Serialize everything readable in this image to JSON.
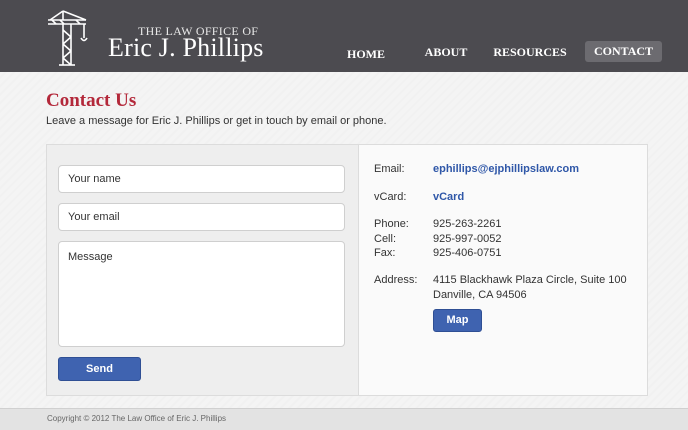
{
  "header": {
    "logo_line1": "THE LAW OFFICE OF",
    "logo_line2": "Eric J. Phillips",
    "logo_icon": "crane-icon",
    "nav": [
      {
        "label": "HOME",
        "active": false
      },
      {
        "label": "ABOUT",
        "active": false
      },
      {
        "label": "RESOURCES",
        "active": false
      },
      {
        "label": "CONTACT",
        "active": true
      }
    ]
  },
  "main": {
    "title": "Contact Us",
    "subtitle": "Leave a message for Eric J. Phillips or get in touch by email or phone."
  },
  "form": {
    "name_placeholder": "Your name",
    "email_placeholder": "Your email",
    "message_placeholder": "Message",
    "send_label": "Send"
  },
  "contact": {
    "email_label": "Email:",
    "email_value": "ephillips@ejphillipslaw.com",
    "vcard_label": "vCard:",
    "vcard_value": "vCard",
    "phone_label": "Phone:",
    "phone_value": "925-263-2261",
    "cell_label": "Cell:",
    "cell_value": "925-997-0052",
    "fax_label": "Fax:",
    "fax_value": "925-406-0751",
    "address_label": "Address:",
    "address_line1": "4115 Blackhawk Plaza Circle, Suite 100",
    "address_line2": "Danville, CA 94506",
    "map_label": "Map"
  },
  "footer": {
    "copyright": "Copyright © 2012 The Law Office of Eric J. Phillips"
  },
  "colors": {
    "header_bg": "#4c4b50",
    "accent_red": "#b3283a",
    "link_blue": "#2f57a8",
    "button_blue": "#3f63b0"
  }
}
